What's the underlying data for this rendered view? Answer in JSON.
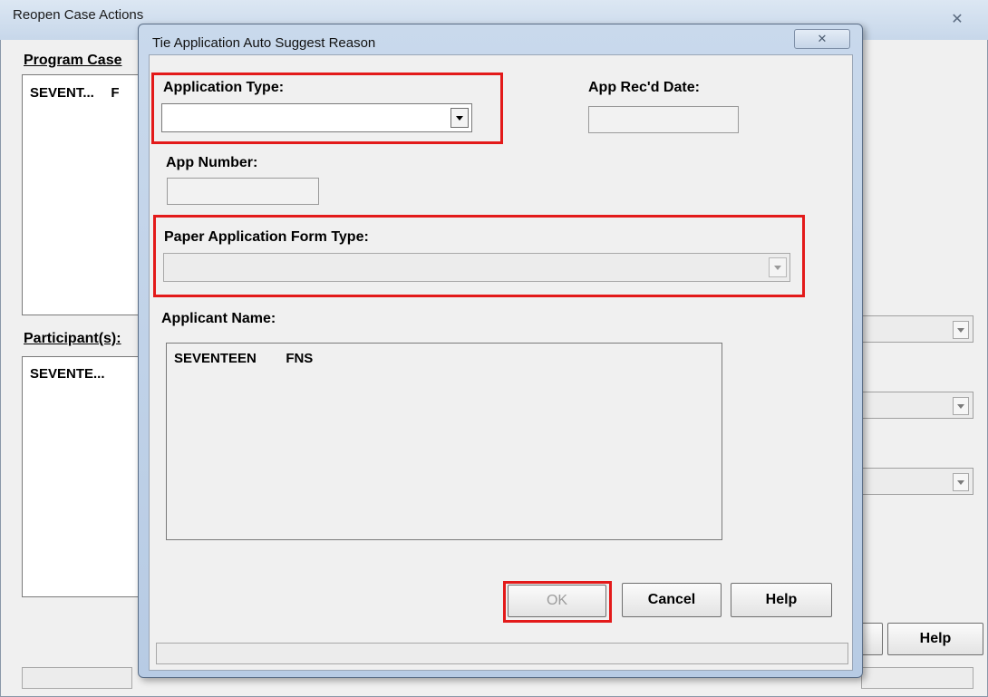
{
  "background": {
    "window_title": "Reopen Case Actions",
    "close_glyph": "✕",
    "program_case_label": "Program Case",
    "program_case_rows": [
      {
        "col1": "SEVENT...",
        "col2": "F"
      }
    ],
    "participants_label": "Participant(s):",
    "participant_rows": [
      {
        "col1": "SEVENTE..."
      }
    ],
    "help_button": "Help"
  },
  "dialog": {
    "title": "Tie Application Auto Suggest Reason",
    "close_glyph": "✕",
    "application_type_label": "Application Type:",
    "application_type_value": "",
    "app_recd_date_label": "App Rec'd Date:",
    "app_recd_date_value": "",
    "app_number_label": "App Number:",
    "app_number_value": "",
    "paper_form_type_label": "Paper Application Form Type:",
    "paper_form_type_value": "",
    "applicant_name_label": "Applicant Name:",
    "applicants": [
      {
        "first": "SEVENTEEN",
        "last": "FNS"
      }
    ],
    "ok_button": "OK",
    "cancel_button": "Cancel",
    "help_button": "Help"
  },
  "colors": {
    "highlight": "#e31a1a"
  }
}
